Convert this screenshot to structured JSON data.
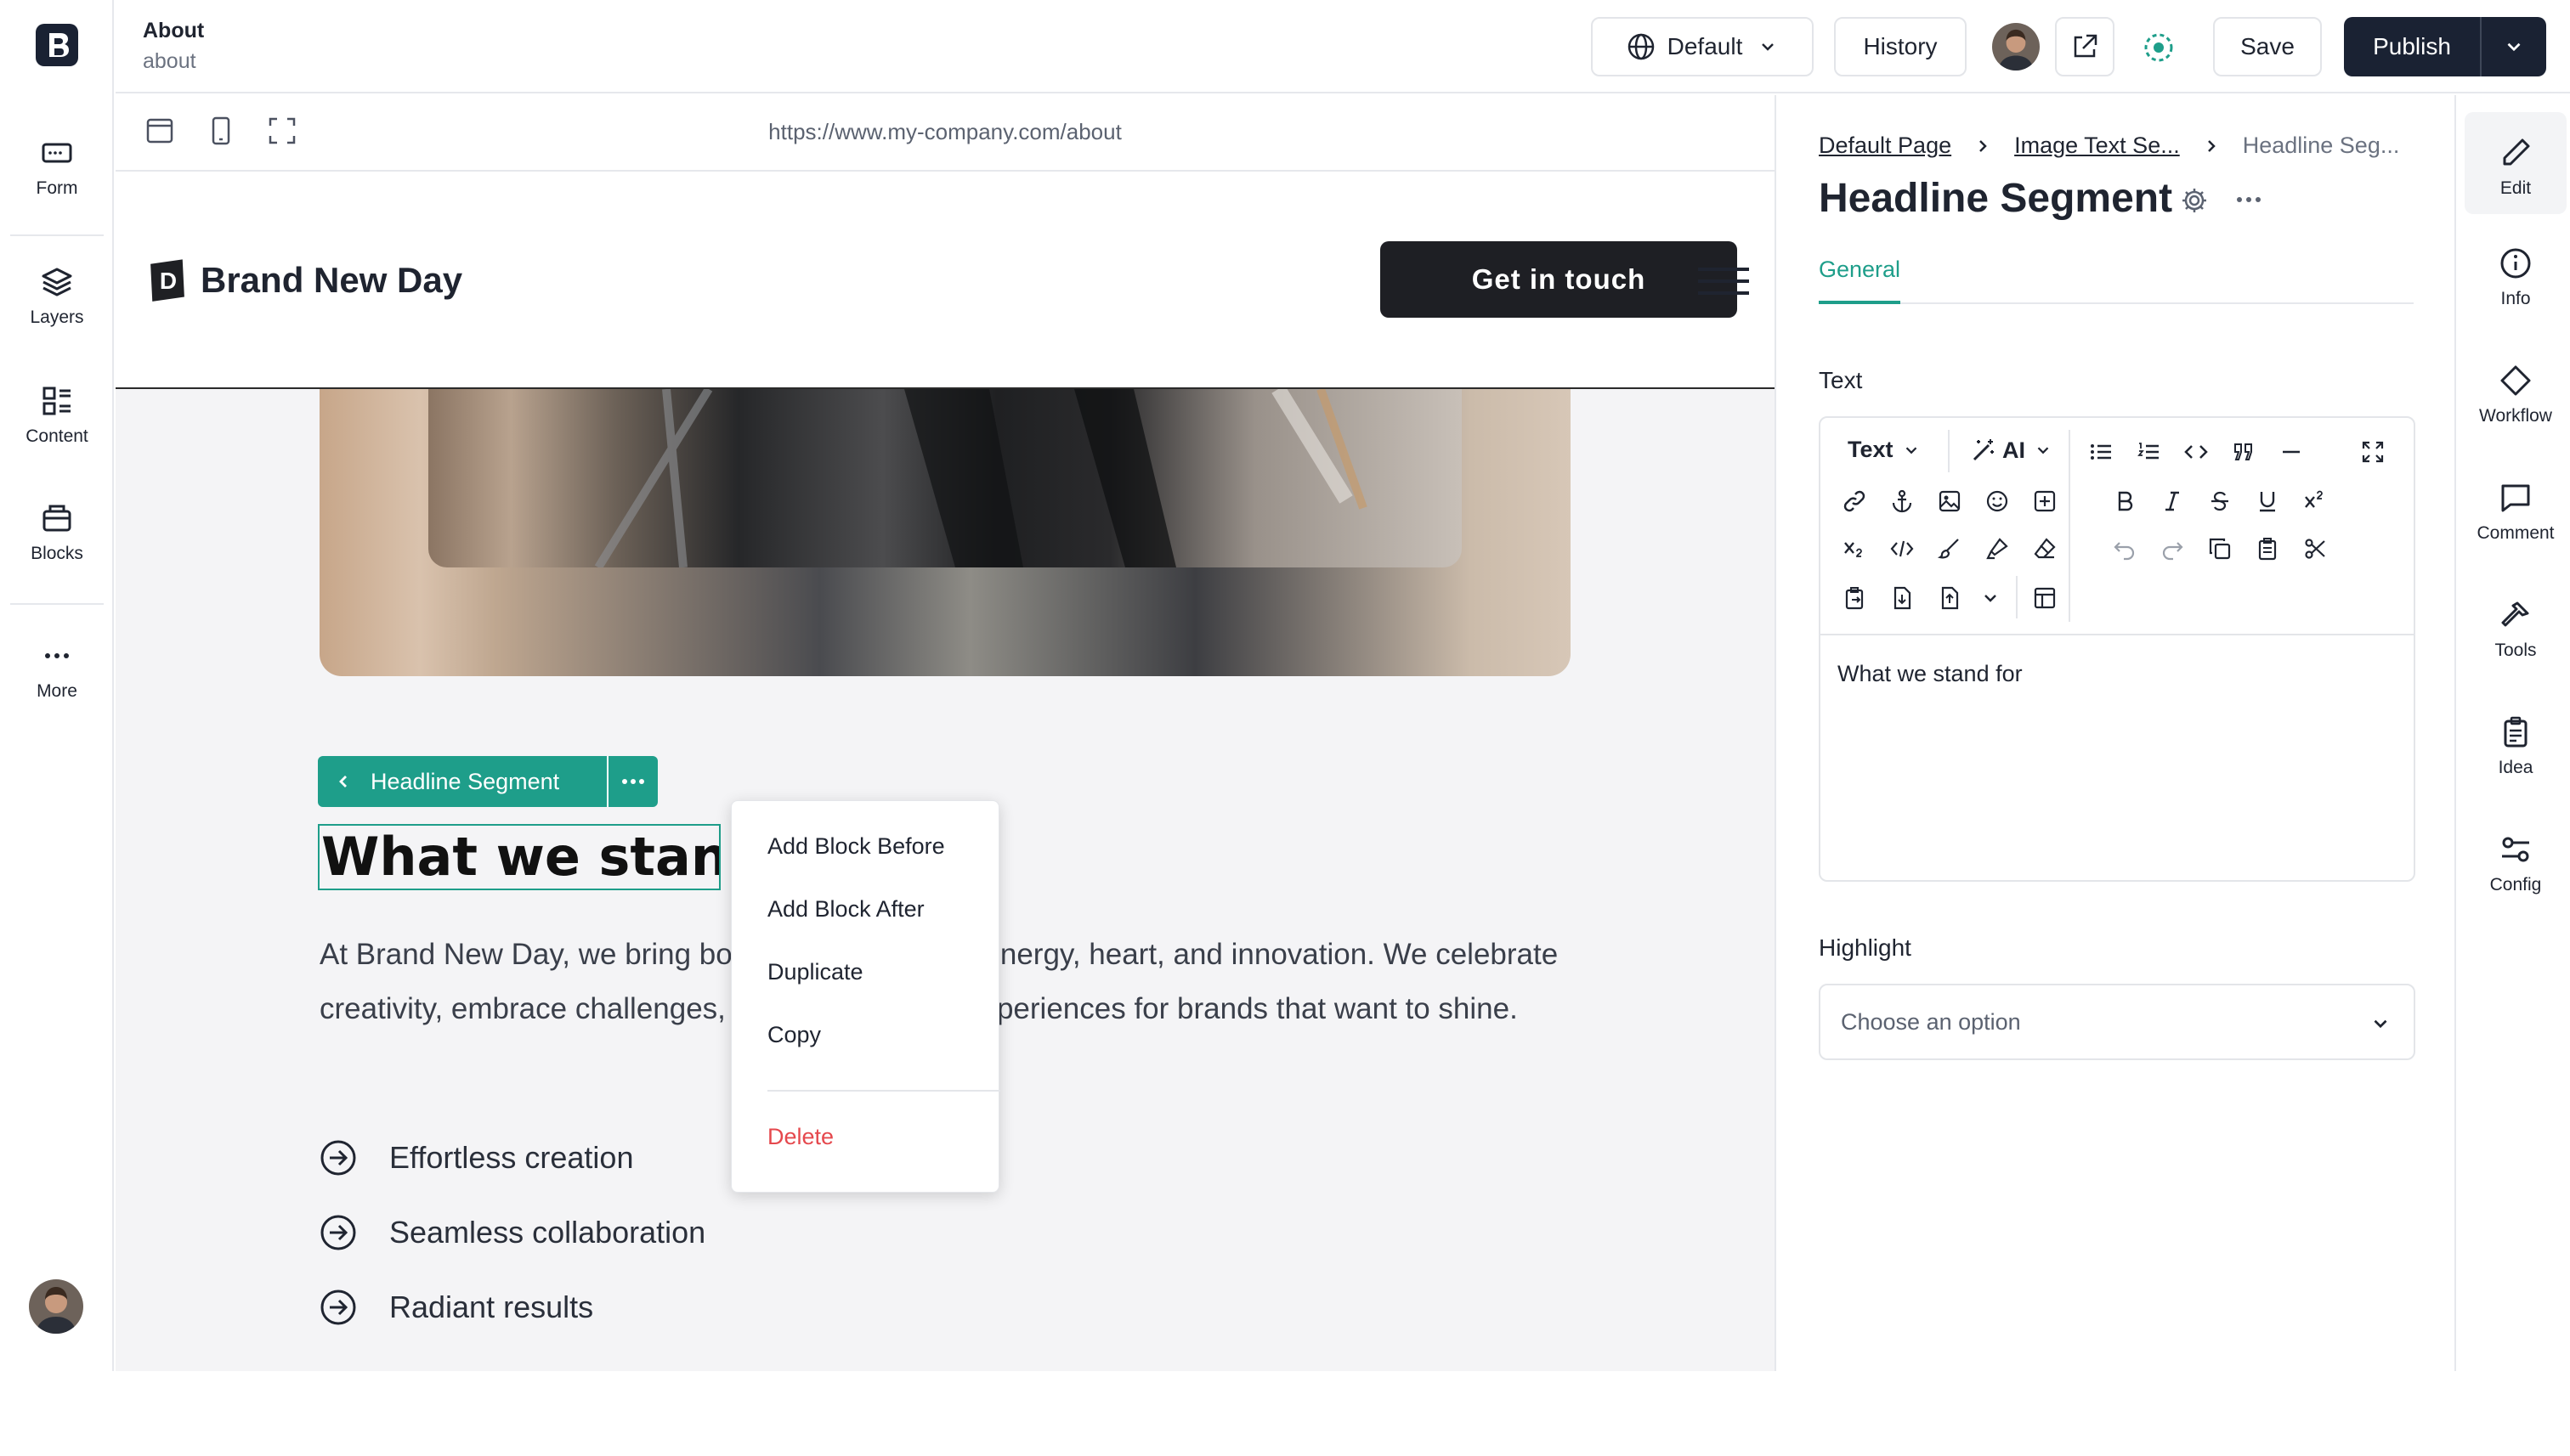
{
  "header": {
    "page_title": "About",
    "page_slug": "about",
    "locale_label": "Default",
    "history_label": "History",
    "save_label": "Save",
    "publish_label": "Publish"
  },
  "left_nav": [
    {
      "label": "Form",
      "icon": "form-icon"
    },
    {
      "label": "Layers",
      "icon": "layers-icon"
    },
    {
      "label": "Content",
      "icon": "content-icon"
    },
    {
      "label": "Blocks",
      "icon": "blocks-icon"
    },
    {
      "label": "More",
      "icon": "more-icon"
    }
  ],
  "viewbar": {
    "url": "https://www.my-company.com/about"
  },
  "canvas": {
    "brand_name": "Brand New Day",
    "brand_mark": "D",
    "cta_label": "Get in touch",
    "segment_toolbar_label": "Headline Segment",
    "headline": "What we stand for",
    "paragraph": "At Brand New Day, we bring bold ideas to life with energy, heart, and innovation. We celebrate creativity, embrace challenges, and deliver joyful experiences for brands that want to shine.",
    "bullets": [
      "Effortless creation",
      "Seamless collaboration",
      "Radiant results"
    ]
  },
  "context_menu": {
    "items": [
      "Add Block Before",
      "Add Block After",
      "Duplicate",
      "Copy"
    ],
    "danger_item": "Delete"
  },
  "right_panel": {
    "breadcrumbs": [
      "Default Page",
      "Image Text Se...",
      "Headline Seg..."
    ],
    "title": "Headline Segment",
    "tabs": [
      "General"
    ],
    "text_label": "Text",
    "editor": {
      "format_label": "Text",
      "ai_label": "AI",
      "content": "What we stand for"
    },
    "highlight_label": "Highlight",
    "highlight_placeholder": "Choose an option"
  },
  "right_rail": [
    {
      "label": "Edit",
      "icon": "pencil-icon"
    },
    {
      "label": "Info",
      "icon": "info-icon"
    },
    {
      "label": "Workflow",
      "icon": "workflow-icon"
    },
    {
      "label": "Comment",
      "icon": "comment-icon"
    },
    {
      "label": "Tools",
      "icon": "tools-icon"
    },
    {
      "label": "Idea",
      "icon": "idea-icon"
    },
    {
      "label": "Config",
      "icon": "config-icon"
    }
  ],
  "colors": {
    "accent": "#1e9e8a",
    "publish": "#1a2233",
    "danger": "#e5484d"
  }
}
